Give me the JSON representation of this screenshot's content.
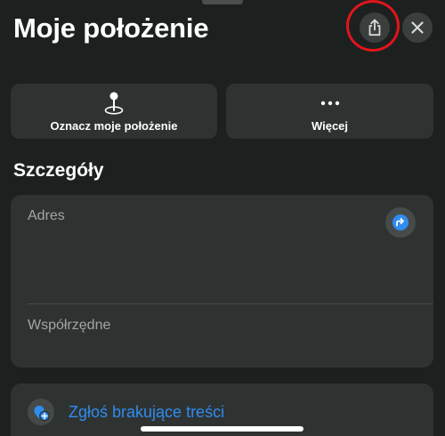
{
  "header": {
    "title": "Moje położenie"
  },
  "actions": {
    "mark_location_label": "Oznacz moje położenie",
    "more_label": "Więcej"
  },
  "details": {
    "section_title": "Szczegóły",
    "address_label": "Adres",
    "coordinates_label": "Współrzędne"
  },
  "report": {
    "label": "Zgłoś brakujące treści"
  },
  "icons": {
    "share": "share-icon",
    "close": "close-icon",
    "pin": "pin-icon",
    "more": "ellipsis-icon",
    "directions": "directions-icon",
    "report": "report-icon"
  },
  "colors": {
    "background": "#1c2120",
    "card": "#2e3332",
    "link_blue": "#2f8cf1",
    "highlight_red": "#e3141b"
  }
}
